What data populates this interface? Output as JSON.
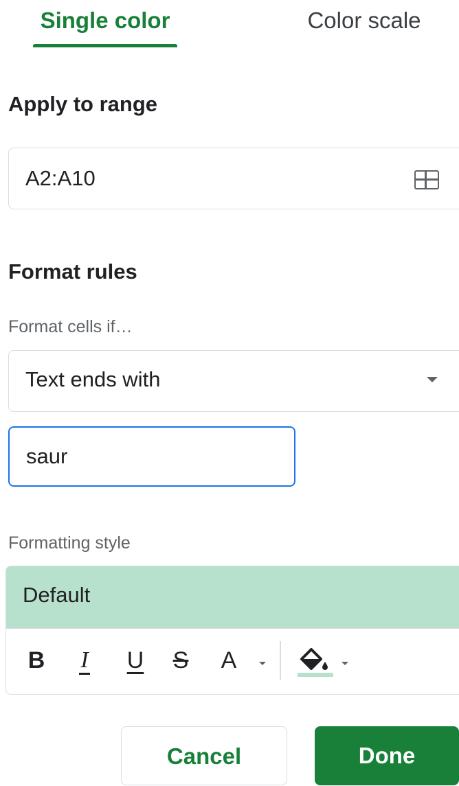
{
  "tabs": [
    {
      "label": "Single color",
      "active": true
    },
    {
      "label": "Color scale",
      "active": false
    }
  ],
  "range": {
    "title": "Apply to range",
    "value": "A2:A10",
    "icon": "select-range-grid-icon"
  },
  "rules": {
    "title": "Format rules",
    "condition_label": "Format cells if…",
    "condition_value": "Text ends with",
    "value_input": "saur"
  },
  "style": {
    "label": "Formatting style",
    "preview_text": "Default",
    "preview_color": "#b7e1cd",
    "toolbar": {
      "bold": "B",
      "italic": "I",
      "underline": "U",
      "strikethrough": "S",
      "text_color": "A"
    }
  },
  "buttons": {
    "cancel": "Cancel",
    "done": "Done"
  },
  "colors": {
    "accent": "#188038",
    "focus": "#1a73e8"
  }
}
